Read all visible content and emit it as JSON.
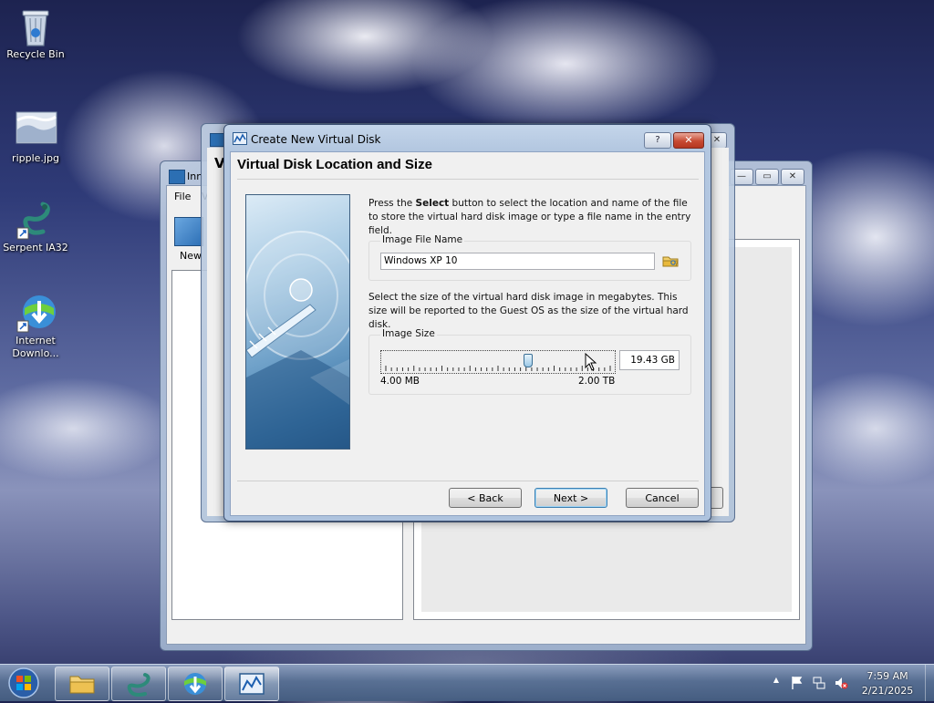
{
  "desktop": {
    "icons": [
      {
        "label": "Recycle Bin"
      },
      {
        "label": "ripple.jpg"
      },
      {
        "label": "Serpent IA32"
      },
      {
        "label": "Internet Downlo..."
      }
    ]
  },
  "background_window": {
    "title": "Inn",
    "menu_file": "File",
    "menu_partial": "V",
    "toolbar_new": "New"
  },
  "middle_window": {
    "title_fragment": "V"
  },
  "dialog": {
    "title": "Create New Virtual Disk",
    "help_label": "?",
    "close_label": "✕",
    "heading": "Virtual Disk Location and Size",
    "intro_pre": "Press the ",
    "intro_bold": "Select",
    "intro_post": " button to select the location and name of the file to store the virtual hard disk image or type a file name in the entry field.",
    "file_group_label": "Image File Name",
    "file_name_value": "Windows XP 10",
    "size_description": "Select the size of the virtual hard disk image in megabytes. This size will be reported to the Guest OS as the size of the virtual hard disk.",
    "size_group_label": "Image Size",
    "size_value": "19.43 GB",
    "slider_min_label": "4.00 MB",
    "slider_max_label": "2.00 TB",
    "slider_position_fraction": 0.63,
    "back_label": "< Back",
    "next_label": "Next >",
    "cancel_label": "Cancel"
  },
  "taskbar": {
    "items": [
      "start-button",
      "file-explorer",
      "serpent",
      "internet-download-manager",
      "virtualbox"
    ],
    "clock_time": "7:59 AM",
    "clock_date": "2/21/2025",
    "tray_expand": "▲"
  },
  "colors": {
    "dialog_frame": "#b3c7e0",
    "close_button": "#c74a33",
    "default_button_border": "#3c7fb1"
  }
}
